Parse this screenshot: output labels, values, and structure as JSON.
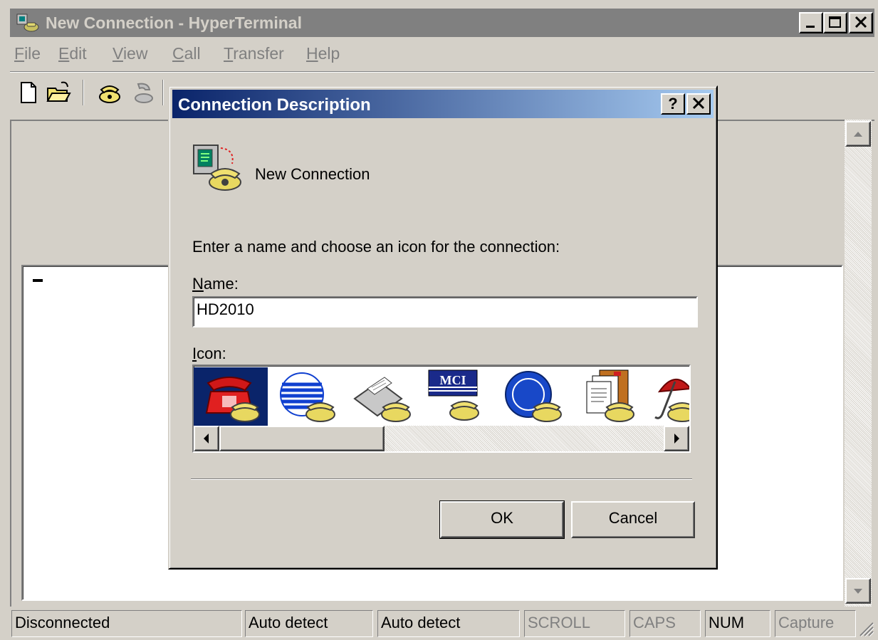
{
  "window": {
    "title": "New Connection - HyperTerminal",
    "title_icon": "hyperterminal-app-icon",
    "caption_buttons": [
      "minimize-icon",
      "maximize-icon",
      "close-icon"
    ]
  },
  "menu": {
    "items": [
      {
        "label": "File",
        "mnemonic": "F",
        "rest": "ile"
      },
      {
        "label": "Edit",
        "mnemonic": "E",
        "rest": "dit"
      },
      {
        "label": "View",
        "mnemonic": "V",
        "rest": "iew"
      },
      {
        "label": "Call",
        "mnemonic": "C",
        "rest": "all"
      },
      {
        "label": "Transfer",
        "mnemonic": "T",
        "rest": "ransfer"
      },
      {
        "label": "Help",
        "mnemonic": "H",
        "rest": "elp"
      }
    ]
  },
  "toolbar": {
    "icons": [
      "new-document-icon",
      "open-folder-icon",
      "call-phone-icon",
      "disconnect-phone-icon",
      "send-receive-icon",
      "properties-icon"
    ]
  },
  "dialog": {
    "title": "Connection Description",
    "help_label": "?",
    "close_label": "✕",
    "connection_name_display": "New Connection",
    "instruction": "Enter a name and choose an icon for the connection:",
    "name_label": "Name:",
    "name_mnemonic": "N",
    "name_label_rest": "ame:",
    "name_value": "HD2010",
    "icon_label": "Icon:",
    "icon_mnemonic": "I",
    "icon_label_rest": "con:",
    "icon_options": [
      {
        "name": "red-phone-icon",
        "selected": true
      },
      {
        "name": "globe-lines-icon",
        "selected": false
      },
      {
        "name": "fax-machine-icon",
        "selected": false
      },
      {
        "name": "mci-logo-icon",
        "selected": false,
        "text": "MCI"
      },
      {
        "name": "ge-logo-icon",
        "selected": false
      },
      {
        "name": "documents-icon",
        "selected": false
      },
      {
        "name": "umbrella-icon",
        "selected": false
      }
    ],
    "ok_label": "OK",
    "cancel_label": "Cancel"
  },
  "status_bar": {
    "panels": [
      {
        "text": "Disconnected",
        "enabled": true
      },
      {
        "text": "Auto detect",
        "enabled": true
      },
      {
        "text": "Auto detect",
        "enabled": true
      },
      {
        "text": "SCROLL",
        "enabled": false
      },
      {
        "text": "CAPS",
        "enabled": false
      },
      {
        "text": "NUM",
        "enabled": true
      },
      {
        "text": "Capture",
        "enabled": false
      }
    ]
  },
  "colors": {
    "face": "#d4d0c8",
    "dialog_title_start": "#0a246a",
    "dialog_title_end": "#a6caf0",
    "selection": "#0a246a",
    "inactive_title": "#808080"
  }
}
